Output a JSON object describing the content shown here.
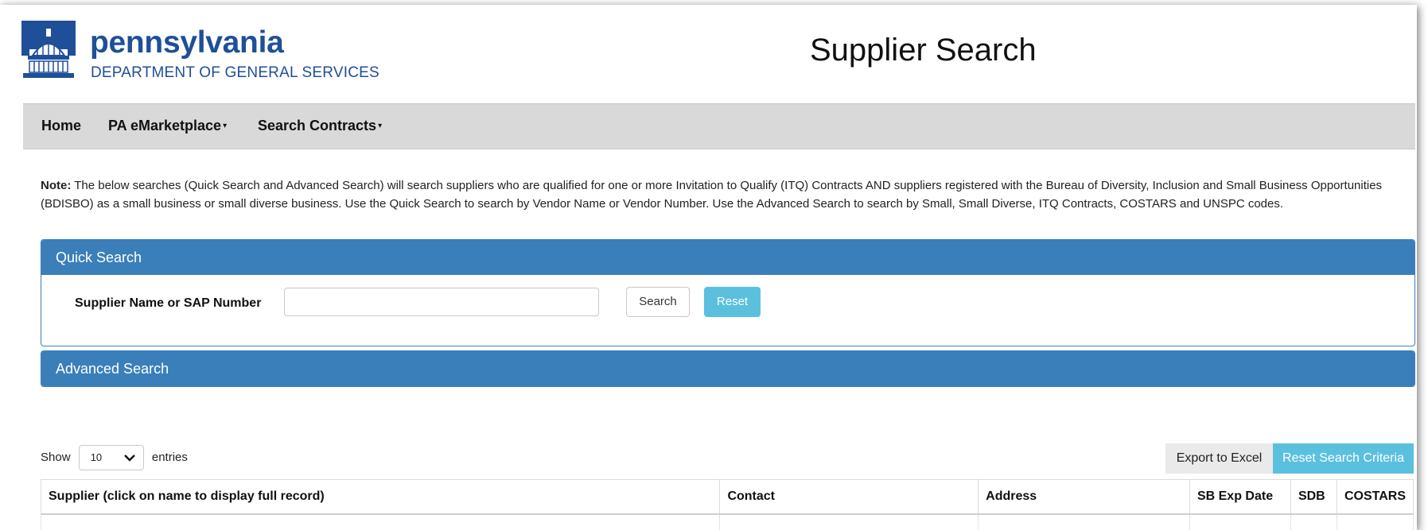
{
  "header": {
    "logo_main": "pennsylvania",
    "logo_sub": "DEPARTMENT OF GENERAL SERVICES",
    "page_title": "Supplier Search"
  },
  "nav": {
    "items": [
      {
        "label": "Home",
        "has_dropdown": false
      },
      {
        "label": "PA eMarketplace",
        "has_dropdown": true
      },
      {
        "label": "Search Contracts",
        "has_dropdown": true
      }
    ]
  },
  "note": {
    "lead": "Note:",
    "text": " The below searches (Quick Search and Advanced Search) will search suppliers who are qualified for one or more Invitation to Qualify (ITQ) Contracts AND suppliers registered with the Bureau of Diversity, Inclusion and Small Business Opportunities (BDISBO) as a small business or small diverse business. Use the Quick Search to search by Vendor Name or Vendor Number. Use the Advanced Search to search by Small, Small Diverse, ITQ Contracts, COSTARS and UNSPC codes."
  },
  "quick_search": {
    "title": "Quick Search",
    "label": "Supplier Name or SAP Number",
    "input_value": "",
    "search_label": "Search",
    "reset_label": "Reset"
  },
  "advanced_search": {
    "title": "Advanced Search"
  },
  "table_controls": {
    "show_label": "Show",
    "entries_value": "10",
    "entries_label": "entries",
    "export_label": "Export to Excel",
    "reset_criteria_label": "Reset Search Criteria"
  },
  "table": {
    "columns": [
      "Supplier (click on name to display full record)",
      "Contact",
      "Address",
      "SB Exp Date",
      "SDB",
      "COSTARS"
    ]
  },
  "colors": {
    "brand_blue": "#1f4f98",
    "panel_blue": "#3a7fba",
    "accent_cyan": "#5bc0de",
    "nav_gray": "#d9d9d9"
  }
}
